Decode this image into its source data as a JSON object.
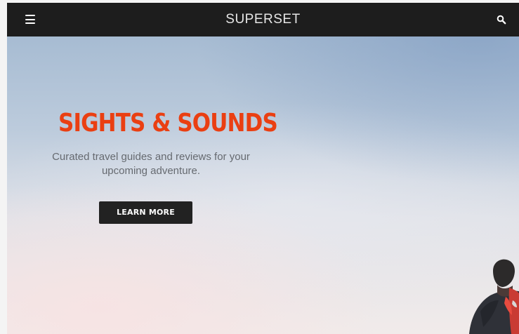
{
  "header": {
    "brand": "SUPERSET",
    "menu_icon": "hamburger-menu-icon",
    "search_icon": "search-icon"
  },
  "hero": {
    "headline": "SIGHTS & SOUNDS",
    "subtitle_line1": "Curated travel guides and reviews for your",
    "subtitle_line2": "upcoming adventure.",
    "cta_label": "LEARN MORE",
    "image": "sky-with-hiker-photo"
  },
  "colors": {
    "topbar": "#1d1d1d",
    "accent": "#ea3f12",
    "button": "#222222",
    "subtitle": "#666a70"
  }
}
